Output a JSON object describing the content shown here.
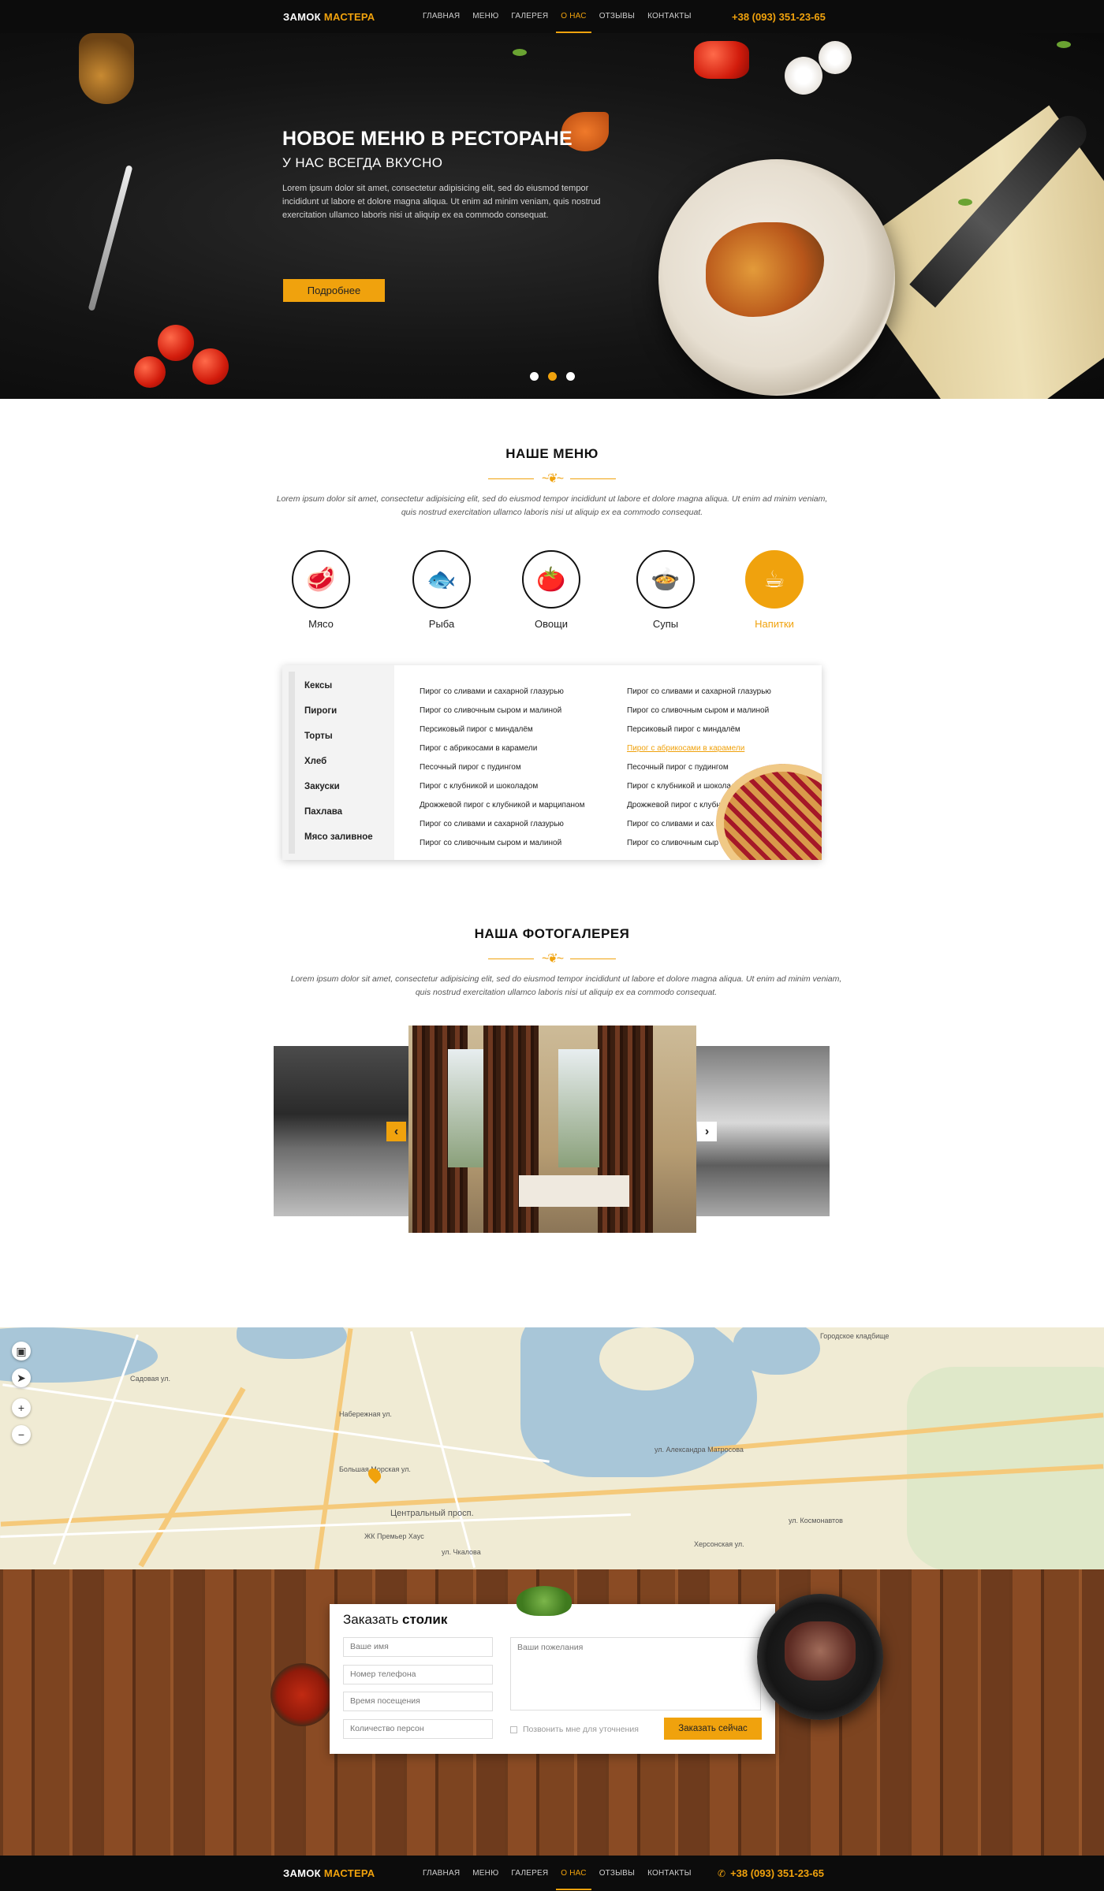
{
  "brand": {
    "part1": "ЗАМОК",
    "part2": "МАСТЕРА"
  },
  "nav": [
    "ГЛАВНАЯ",
    "МЕНЮ",
    "ГАЛЕРЕЯ",
    "О НАС",
    "ОТЗЫВЫ",
    "КОНТАКТЫ"
  ],
  "nav_active": "О НАС",
  "phone": "+38 (093) 351-23-65",
  "colors": {
    "accent": "#f0a20d",
    "bar": "#0c0c0c"
  },
  "hero": {
    "title": "НОВОЕ МЕНЮ В РЕСТОРАНЕ",
    "subtitle": "У НАС ВСЕГДА ВКУСНО",
    "text": "Lorem ipsum dolor sit amet, consectetur adipisicing elit, sed do eiusmod tempor incididunt ut labore et dolore magna aliqua. Ut enim ad minim veniam, quis nostrud exercitation ullamco laboris nisi ut aliquip ex ea commodo consequat.",
    "button": "Подробнее",
    "slides_total": 3,
    "slide_active": 2
  },
  "menu_section": {
    "title": "НАШЕ МЕНЮ",
    "desc_line1": "Lorem ipsum dolor sit amet, consectetur adipisicing elit, sed do eiusmod tempor incididunt ut labore et dolore magna aliqua. Ut enim ad minim veniam,",
    "desc_line2": "quis nostrud exercitation ullamco laboris nisi ut aliquip ex ea commodo consequat.",
    "categories": [
      {
        "label": "Мясо",
        "icon": "meat-icon"
      },
      {
        "label": "Рыба",
        "icon": "fish-icon"
      },
      {
        "label": "Овощи",
        "icon": "tomato-icon"
      },
      {
        "label": "Супы",
        "icon": "pot-icon"
      },
      {
        "label": "Напитки",
        "icon": "coffee-cup-icon"
      }
    ],
    "active_category": "Напитки",
    "subcategories": [
      "Кексы",
      "Пироги",
      "Торты",
      "Хлеб",
      "Закуски",
      "Пахлава",
      "Мясо заливное"
    ],
    "col1": [
      "Пирог со сливами и сахарной глазурью",
      "Пирог со сливочным сыром и малиной",
      "Персиковый пирог с миндалём",
      "Пирог с абрикосами в карамели",
      "Песочный пирог с пудингом",
      "Пирог с клубникой и шоколадом",
      "Дрожжевой пирог с клубникой и марципаном",
      "Пирог со сливами и сахарной глазурью",
      "Пирог со сливочным сыром и малиной"
    ],
    "col2": [
      "Пирог со сливами и сахарной глазурью",
      "Пирог со сливочным сыром и малиной",
      "Персиковый пирог с миндалём",
      "Пирог с абрикосами в карамели",
      "Песочный пирог с пудингом",
      "Пирог с клубникой и шоколад",
      "Дрожжевой пирог с клубн",
      "Пирог со сливами и сах",
      "Пирог со сливочным сыр"
    ],
    "highlighted_item": "Пирог с абрикосами в карамели"
  },
  "gallery": {
    "title": "НАША ФОТОГАЛЕРЕЯ",
    "desc_line1": "Lorem ipsum dolor sit amet, consectetur adipisicing elit, sed do eiusmod tempor incididunt ut labore et dolore magna aliqua. Ut enim ad minim veniam,",
    "desc_line2": "quis nostrud exercitation ullamco laboris nisi ut aliquip ex ea commodo consequat.",
    "prev": "‹",
    "next": "›"
  },
  "map": {
    "streets": [
      "Центральный просп.",
      "Набережная ул.",
      "Большая Морская ул.",
      "Садовая ул.",
      "ЖК Премьер Хаус",
      "ул. Чкалова",
      "ул. Космонавтов",
      "ул. Александра Матросова",
      "Херсонская ул.",
      "Городское кладбище"
    ],
    "controls": [
      "+",
      "−"
    ]
  },
  "reservation": {
    "title_normal": "Заказать ",
    "title_bold": "столик",
    "name_ph": "Ваше имя",
    "phone_ph": "Номер телефона",
    "time_ph": "Время посещения",
    "persons_ph": "Количество персон",
    "wishes_ph": "Ваши пожелания",
    "callback": "Позвонить мне для уточнения",
    "submit": "Заказать сейчас"
  }
}
